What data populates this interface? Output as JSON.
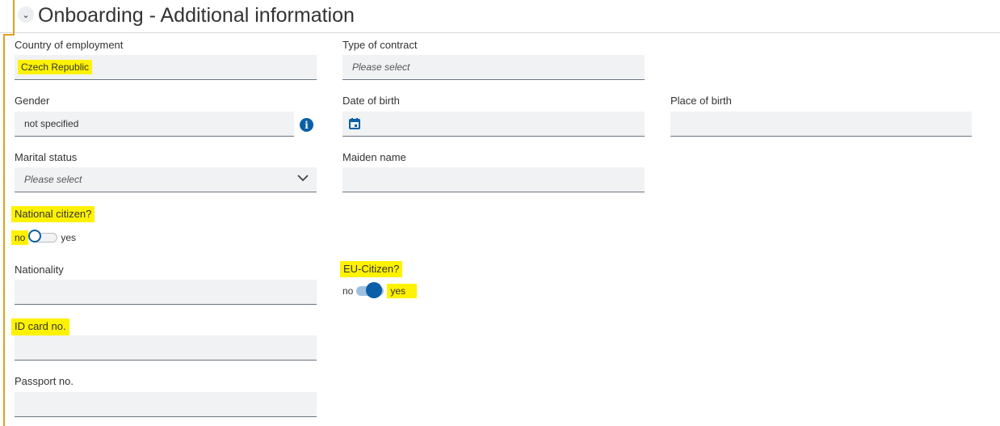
{
  "section": {
    "title": "Onboarding - Additional information",
    "collapse_icon": "chevron-down-icon"
  },
  "fields": {
    "country": {
      "label": "Country of employment",
      "value": "Czech Republic"
    },
    "contract": {
      "label": "Type of contract",
      "placeholder": "Please select"
    },
    "gender": {
      "label": "Gender",
      "value": "not specified",
      "info_icon": "info-icon"
    },
    "dob": {
      "label": "Date of birth",
      "value": ""
    },
    "pob": {
      "label": "Place of birth",
      "value": ""
    },
    "marital": {
      "label": "Marital status",
      "placeholder": "Please select"
    },
    "maiden": {
      "label": "Maiden name",
      "value": ""
    },
    "national_citizen": {
      "label": "National citizen?",
      "off_label": "no",
      "on_label": "yes",
      "state": "no"
    },
    "nationality": {
      "label": "Nationality",
      "value": ""
    },
    "eu_citizen": {
      "label": "EU-Citizen?",
      "off_label": "no",
      "on_label": "yes",
      "state": "yes"
    },
    "id_card": {
      "label": "ID card no.",
      "value": ""
    },
    "passport": {
      "label": "Passport no.",
      "value": ""
    }
  },
  "colors": {
    "highlight": "#fff200",
    "accent": "#0a5fa8",
    "section_border": "#e0a020",
    "field_bg": "#f1f2f4"
  }
}
